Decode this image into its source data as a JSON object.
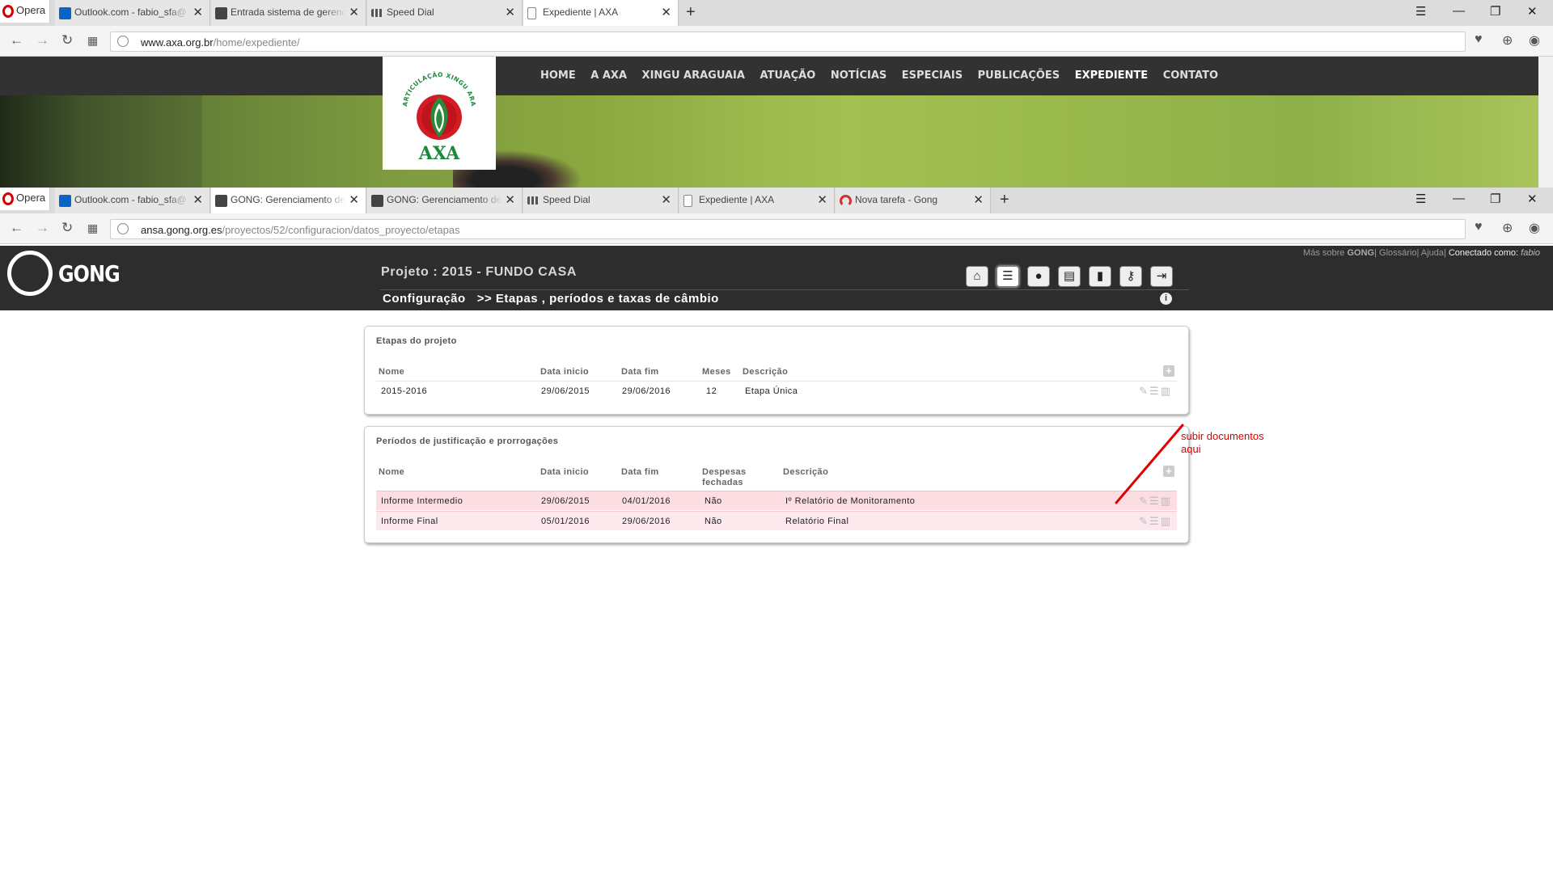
{
  "browser1": {
    "opera_label": "Opera",
    "tabs": [
      {
        "label": "Outlook.com - fabio_sfa@"
      },
      {
        "label": "Entrada sistema de gerenc"
      },
      {
        "label": "Speed Dial"
      },
      {
        "label": "Expediente | AXA"
      }
    ],
    "url_domain": "www.axa.org.br",
    "url_path": "/home/expediente/"
  },
  "axa": {
    "menu": [
      "HOME",
      "A AXA",
      "XINGU ARAGUAIA",
      "ATUAÇÃO",
      "NOTÍCIAS",
      "ESPECIAIS",
      "PUBLICAÇÕES",
      "EXPEDIENTE",
      "CONTATO"
    ],
    "logo_arc_text": "ARTICULAÇÃO XINGU ARAGUAIA",
    "logo_text": "AXA"
  },
  "browser2": {
    "opera_label": "Opera",
    "tabs": [
      {
        "label": "Outlook.com - fabio_sfa@"
      },
      {
        "label": "GONG: Gerenciamento de"
      },
      {
        "label": "GONG: Gerenciamento de"
      },
      {
        "label": "Speed Dial"
      },
      {
        "label": "Expediente | AXA"
      },
      {
        "label": "Nova tarefa - Gong"
      }
    ],
    "url_domain": "ansa.gong.org.es",
    "url_path": "/proyectos/52/configuracion/datos_proyecto/etapas"
  },
  "gong": {
    "logo_text": "GONG",
    "project_title": "Projeto : 2015 - FUNDO CASA",
    "crumb_section": "Configuração",
    "crumb_page": ">> Etapas , períodos e taxas de câmbio",
    "toplinks": {
      "mas_sobre": "Más sobre",
      "brand": "GONG",
      "glossario": "Glossário",
      "ajuda": "Ajuda",
      "conectado": "Conectado como:",
      "user": "fabio"
    },
    "toolbar_icons": [
      "home-icon",
      "database-icon",
      "user-icon",
      "folder-icon",
      "chart-icon",
      "key-icon",
      "exit-icon"
    ]
  },
  "etapas": {
    "title": "Etapas do projeto",
    "headers": [
      "Nome",
      "Data inicio",
      "Data fim",
      "Meses",
      "Descrição"
    ],
    "rows": [
      {
        "nome": "2015-2016",
        "inicio": "29/06/2015",
        "fim": "29/06/2016",
        "meses": "12",
        "descricao": "Etapa Única"
      }
    ]
  },
  "periodos": {
    "title": "Períodos de justificação e prorrogações",
    "headers": [
      "Nome",
      "Data inicio",
      "Data fim",
      "Despesas fechadas",
      "Descrição"
    ],
    "rows": [
      {
        "nome": "Informe Intermedio",
        "inicio": "29/06/2015",
        "fim": "04/01/2016",
        "despesas": "Não",
        "descricao": "Iº Relatório de Monitoramento"
      },
      {
        "nome": "Informe Final",
        "inicio": "05/01/2016",
        "fim": "29/06/2016",
        "despesas": "Não",
        "descricao": "Relatório Final"
      }
    ]
  },
  "annotation": {
    "line1": "subir documentos",
    "line2": "aqui",
    "color": "#e00000"
  }
}
